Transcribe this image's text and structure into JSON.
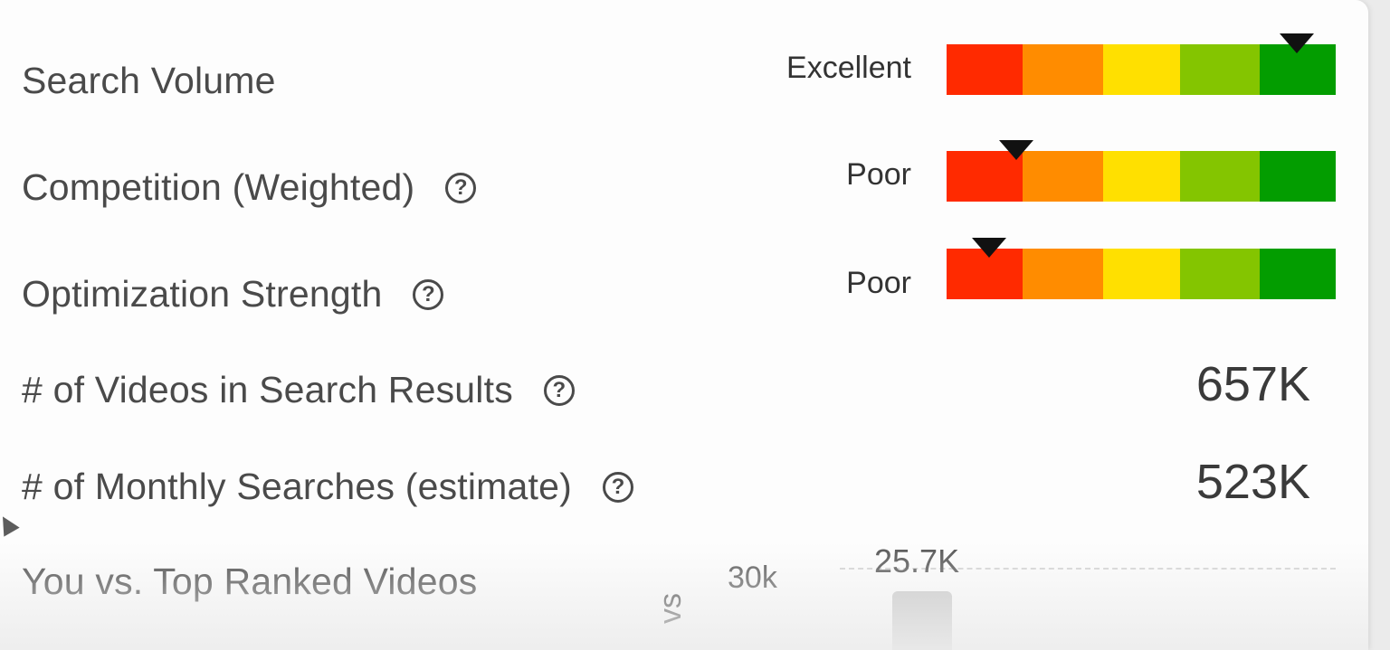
{
  "metrics": [
    {
      "label": "Search Volume",
      "has_help": false,
      "rating": "Excellent",
      "marker_level": 0.9
    },
    {
      "label": "Competition (Weighted)",
      "has_help": true,
      "rating": "Poor",
      "marker_level": 0.18
    },
    {
      "label": "Optimization Strength",
      "has_help": true,
      "rating": "Poor",
      "marker_level": 0.11
    }
  ],
  "counts": [
    {
      "label": "# of Videos in Search Results",
      "value": "657K"
    },
    {
      "label": "# of Monthly Searches (estimate)",
      "value": "523K"
    }
  ],
  "help_glyph": "?",
  "comparison": {
    "label": "You vs. Top Ranked Videos",
    "y_tick": "30k",
    "bar_value": "25.7K",
    "axis_fragment": "vs"
  },
  "meter_colors": [
    "#ff2a00",
    "#ff8c00",
    "#ffe000",
    "#84c500",
    "#039d00"
  ],
  "chart_data": {
    "type": "bar",
    "categories": [
      ""
    ],
    "values": [
      25700
    ],
    "ylim": [
      0,
      30000
    ],
    "ytick_labels": [
      "30k"
    ],
    "data_labels": [
      "25.7K"
    ]
  }
}
